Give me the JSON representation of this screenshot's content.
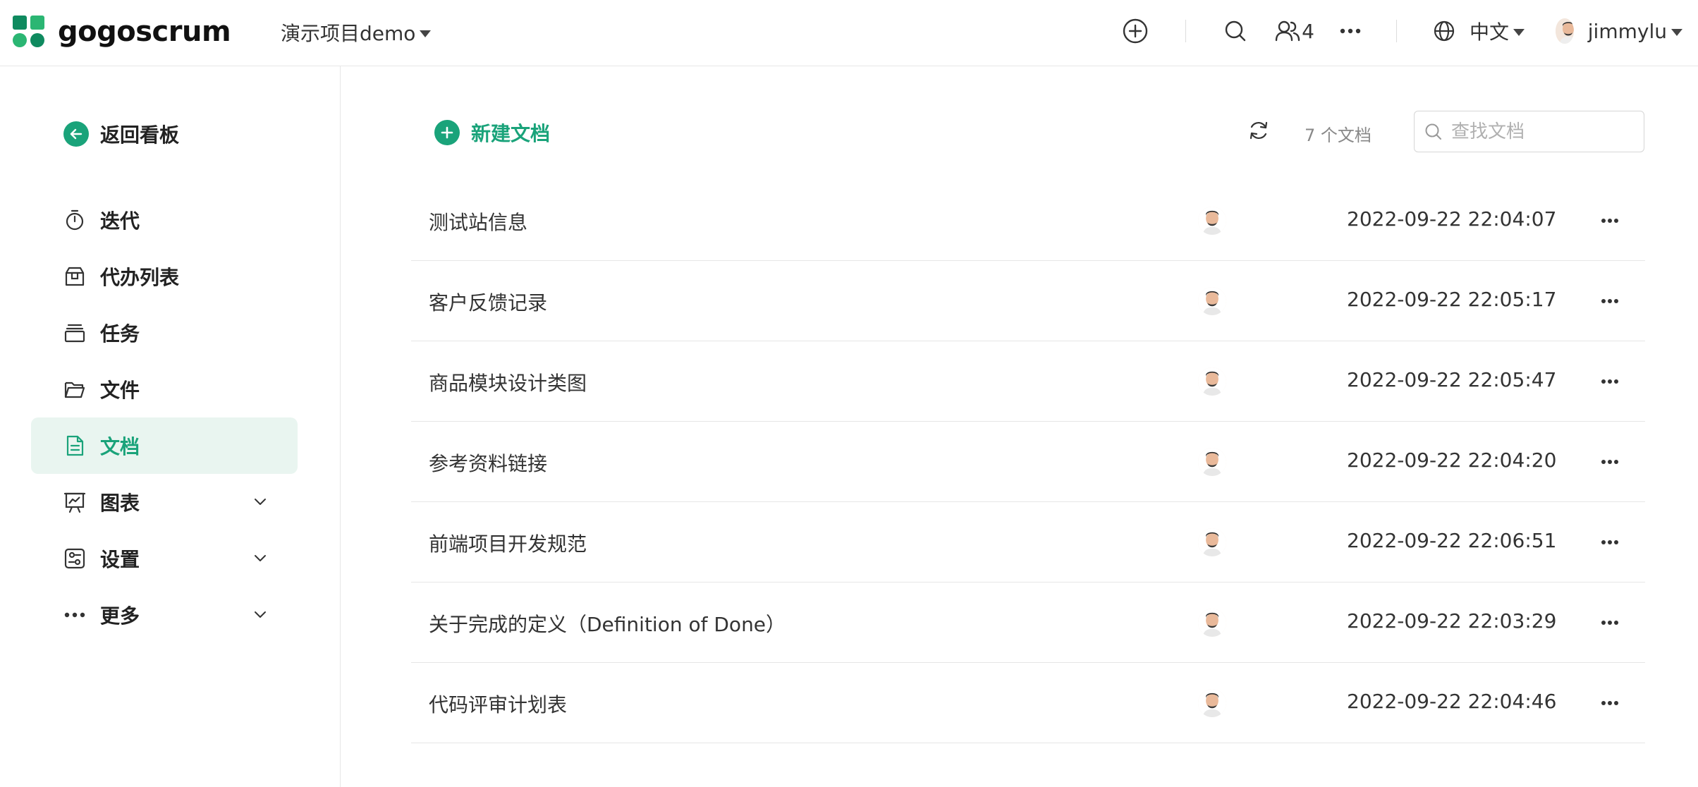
{
  "header": {
    "logo_text": "gogoscrum",
    "project_name": "演示项目demo",
    "member_count": "4",
    "language": "中文",
    "username": "jimmylu"
  },
  "sidebar": {
    "back_label": "返回看板",
    "items": [
      {
        "label": "迭代",
        "icon": "timer-icon"
      },
      {
        "label": "代办列表",
        "icon": "backlog-icon"
      },
      {
        "label": "任务",
        "icon": "tasks-icon"
      },
      {
        "label": "文件",
        "icon": "folder-icon"
      },
      {
        "label": "文档",
        "icon": "document-icon",
        "active": true
      },
      {
        "label": "图表",
        "icon": "chart-icon",
        "expandable": true
      },
      {
        "label": "设置",
        "icon": "settings-icon",
        "expandable": true
      },
      {
        "label": "更多",
        "icon": "more-icon",
        "expandable": true
      }
    ]
  },
  "main": {
    "new_doc_label": "新建文档",
    "doc_count": "7 个文档",
    "search_placeholder": "查找文档",
    "documents": [
      {
        "title": "测试站信息",
        "time": "2022-09-22 22:04:07"
      },
      {
        "title": "客户反馈记录",
        "time": "2022-09-22 22:05:17"
      },
      {
        "title": "商品模块设计类图",
        "time": "2022-09-22 22:05:47"
      },
      {
        "title": "参考资料链接",
        "time": "2022-09-22 22:04:20"
      },
      {
        "title": "前端项目开发规范",
        "time": "2022-09-22 22:06:51"
      },
      {
        "title": "关于完成的定义（Definition of Done）",
        "time": "2022-09-22 22:03:29"
      },
      {
        "title": "代码评审计划表",
        "time": "2022-09-22 22:04:46"
      }
    ]
  },
  "colors": {
    "accent": "#1aa37a",
    "active_bg": "#e9f5f0",
    "border": "#e6e6e6"
  }
}
